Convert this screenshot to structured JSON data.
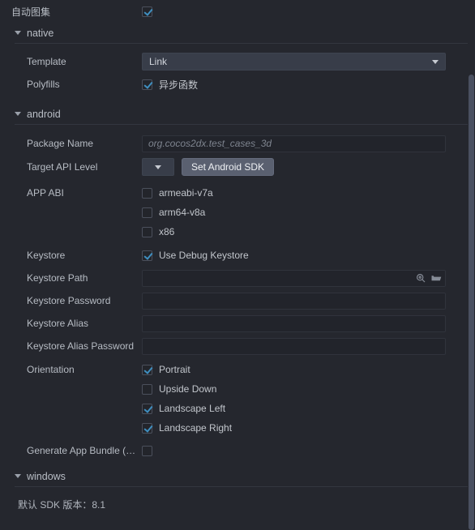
{
  "top": {
    "auto_atlas_label": "自动图集",
    "auto_atlas_checked": true
  },
  "sections": {
    "native": {
      "title": "native",
      "template_label": "Template",
      "template_value": "Link",
      "polyfills_label": "Polyfills",
      "polyfills_option": "异步函数",
      "polyfills_checked": true
    },
    "android": {
      "title": "android",
      "package_name_label": "Package Name",
      "package_name_placeholder": "org.cocos2dx.test_cases_3d",
      "package_name_value": "",
      "target_api_label": "Target API Level",
      "target_api_value": "",
      "set_android_sdk_button": "Set Android SDK",
      "app_abi_label": "APP ABI",
      "app_abi": [
        {
          "label": "armeabi-v7a",
          "checked": false
        },
        {
          "label": "arm64-v8a",
          "checked": false
        },
        {
          "label": "x86",
          "checked": false
        }
      ],
      "keystore_label": "Keystore",
      "use_debug_keystore_label": "Use Debug Keystore",
      "use_debug_keystore_checked": true,
      "keystore_path_label": "Keystore Path",
      "keystore_path_value": "",
      "keystore_password_label": "Keystore Password",
      "keystore_password_value": "",
      "keystore_alias_label": "Keystore Alias",
      "keystore_alias_value": "",
      "keystore_alias_password_label": "Keystore Alias Password",
      "keystore_alias_password_value": "",
      "orientation_label": "Orientation",
      "orientation": [
        {
          "label": "Portrait",
          "checked": true
        },
        {
          "label": "Upside Down",
          "checked": false
        },
        {
          "label": "Landscape Left",
          "checked": true
        },
        {
          "label": "Landscape Right",
          "checked": true
        }
      ],
      "app_bundle_label": "Generate App Bundle (Go…",
      "app_bundle_checked": false
    },
    "windows": {
      "title": "windows",
      "sdk_note": "默认 SDK 版本：8.1"
    }
  },
  "icons": {
    "search": "search-icon",
    "folder": "folder-icon"
  },
  "colors": {
    "background": "#25272e",
    "accent_check": "#3f8fc0",
    "button": "#5a6070",
    "select": "#383d49"
  }
}
